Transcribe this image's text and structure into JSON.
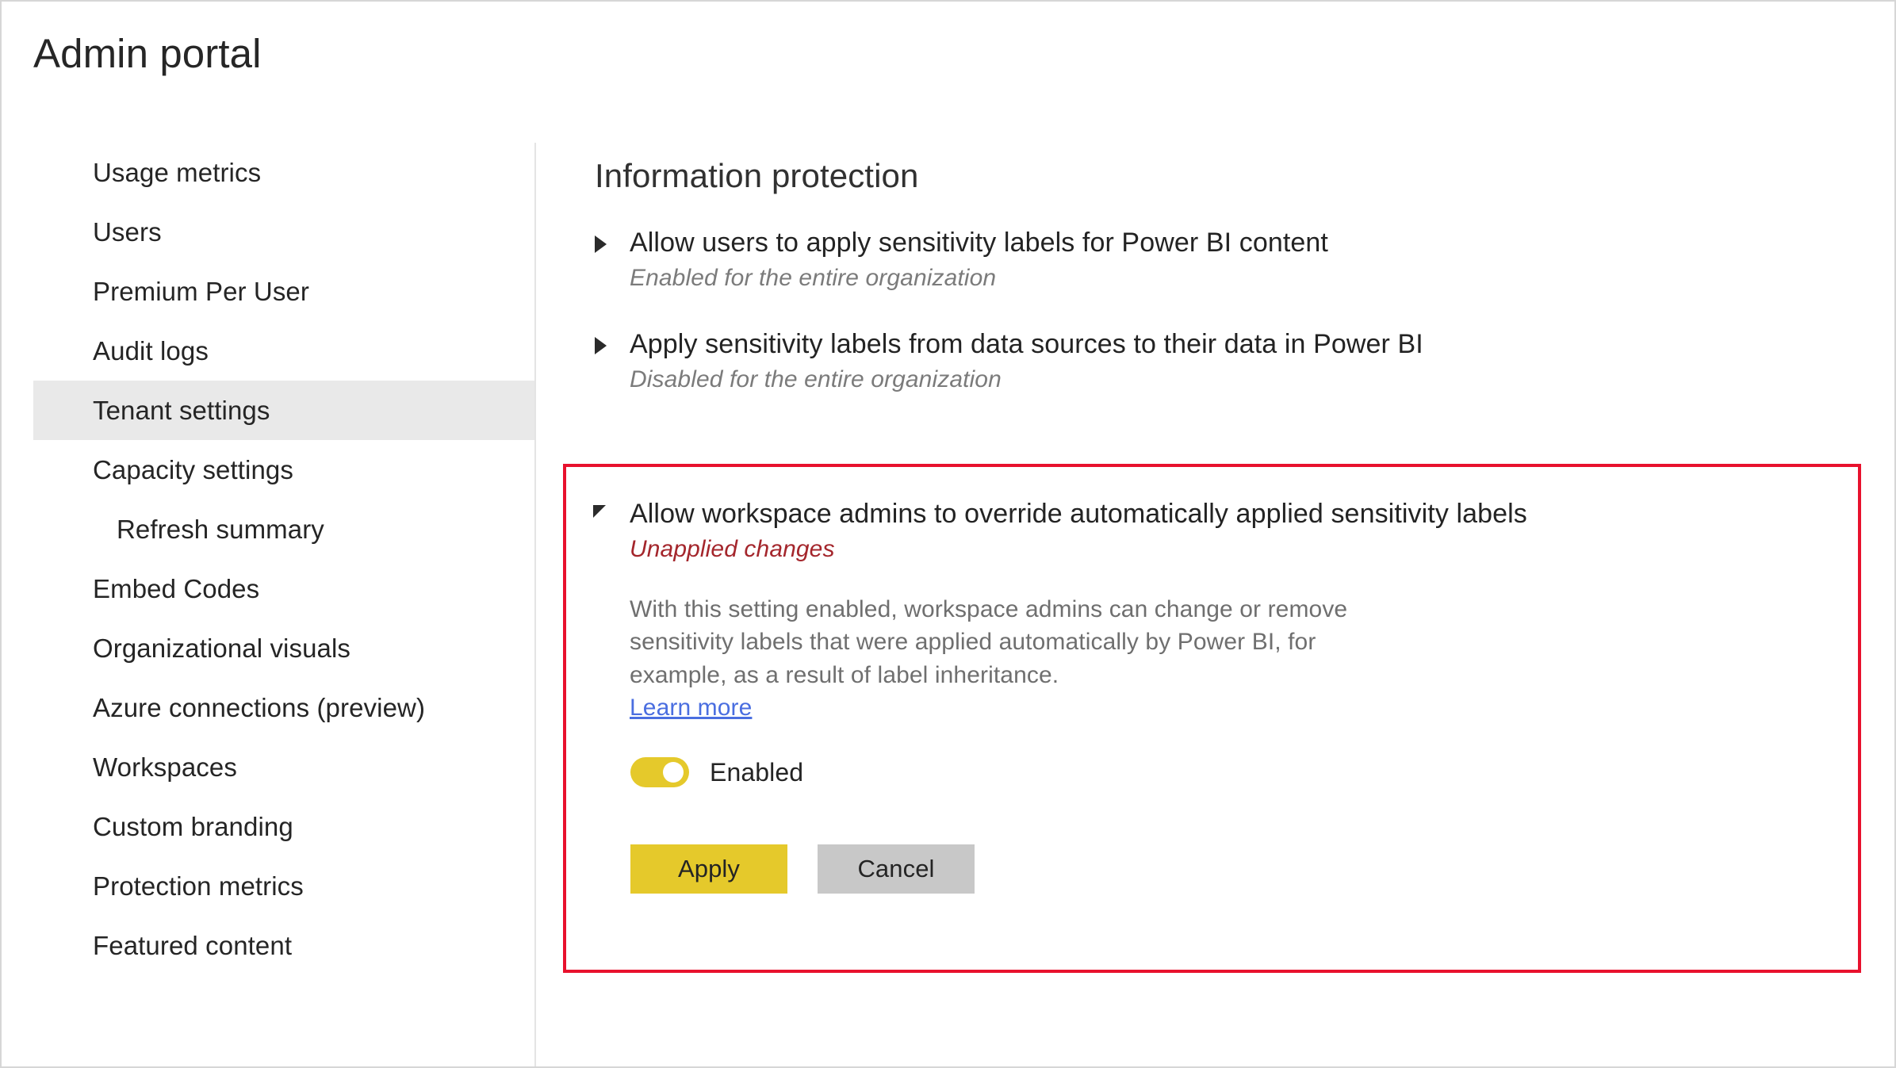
{
  "header": {
    "title": "Admin portal"
  },
  "sidebar": {
    "items": [
      {
        "label": "Usage metrics",
        "selected": false,
        "sub": false
      },
      {
        "label": "Users",
        "selected": false,
        "sub": false
      },
      {
        "label": "Premium Per User",
        "selected": false,
        "sub": false
      },
      {
        "label": "Audit logs",
        "selected": false,
        "sub": false
      },
      {
        "label": "Tenant settings",
        "selected": true,
        "sub": false
      },
      {
        "label": "Capacity settings",
        "selected": false,
        "sub": false
      },
      {
        "label": "Refresh summary",
        "selected": false,
        "sub": true
      },
      {
        "label": "Embed Codes",
        "selected": false,
        "sub": false
      },
      {
        "label": "Organizational visuals",
        "selected": false,
        "sub": false
      },
      {
        "label": "Azure connections (preview)",
        "selected": false,
        "sub": false
      },
      {
        "label": "Workspaces",
        "selected": false,
        "sub": false
      },
      {
        "label": "Custom branding",
        "selected": false,
        "sub": false
      },
      {
        "label": "Protection metrics",
        "selected": false,
        "sub": false
      },
      {
        "label": "Featured content",
        "selected": false,
        "sub": false
      }
    ]
  },
  "main": {
    "heading": "Information protection",
    "settings": [
      {
        "title": "Allow users to apply sensitivity labels for Power BI content",
        "status": "Enabled for the entire organization",
        "expanded": false,
        "chevron_icon": "chevron-right-icon"
      },
      {
        "title": "Apply sensitivity labels from data sources to their data in Power BI",
        "status": "Disabled for the entire organization",
        "expanded": false,
        "chevron_icon": "chevron-right-icon"
      }
    ],
    "expanded_setting": {
      "title": "Allow workspace admins to override automatically applied sensitivity labels",
      "status": "Unapplied changes",
      "chevron_icon": "chevron-collapse-icon",
      "description": "With this setting enabled, workspace admins can change or remove sensitivity labels that were applied automatically by Power BI, for example, as a result of label inheritance.",
      "learn_more_label": "Learn more",
      "toggle": {
        "label": "Enabled",
        "state": "on"
      },
      "apply_label": "Apply",
      "cancel_label": "Cancel"
    }
  },
  "colors": {
    "accent_yellow": "#e5c92b",
    "highlight_red": "#e8112d",
    "unapplied_red": "#a4262c",
    "link_blue": "#4a6ee0",
    "cancel_gray": "#c8c8c8",
    "selected_row_gray": "#e9e9e9"
  }
}
